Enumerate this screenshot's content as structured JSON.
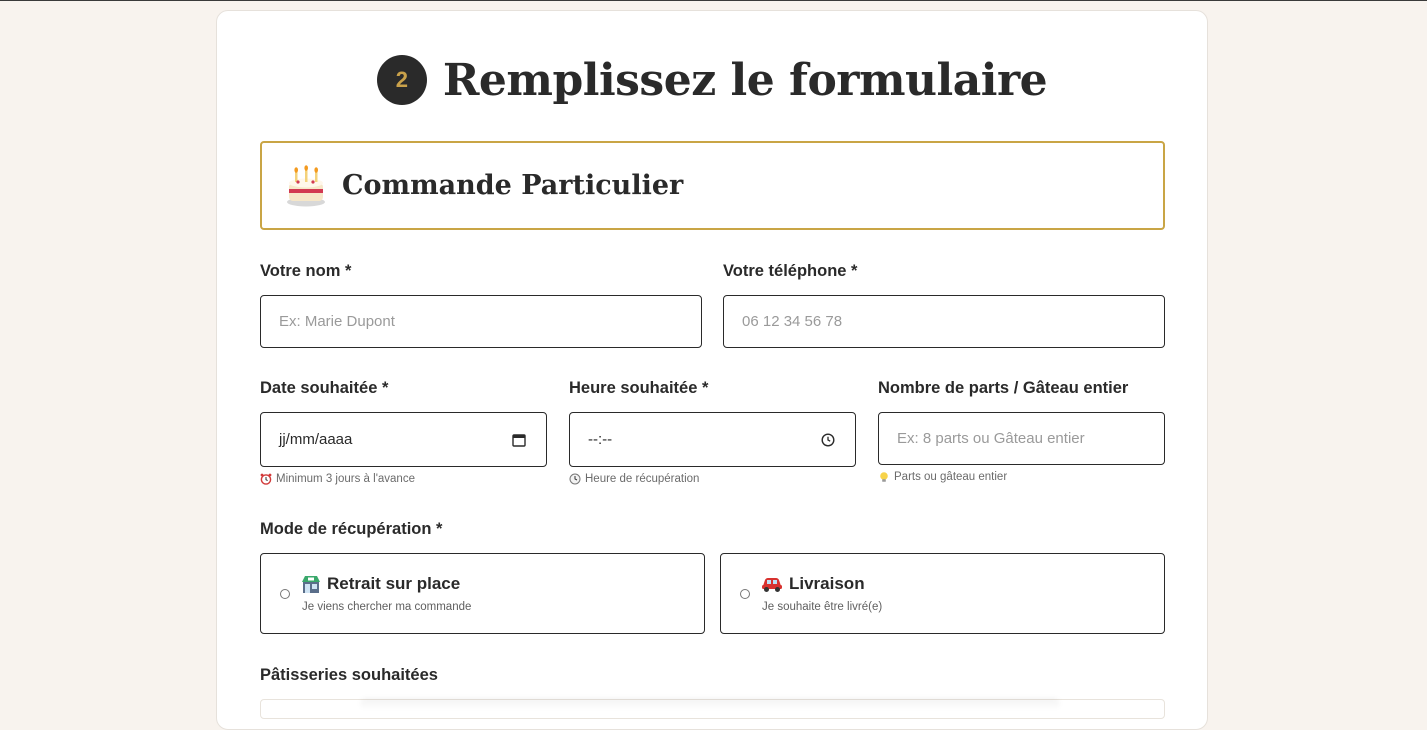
{
  "step": {
    "number": "2",
    "title": "Remplissez le formulaire"
  },
  "order_type": {
    "icon": "birthday-cake-icon",
    "title": "Commande Particulier"
  },
  "fields": {
    "name": {
      "label": "Votre nom *",
      "placeholder": "Ex: Marie Dupont"
    },
    "phone": {
      "label": "Votre téléphone *",
      "placeholder": "06 12 34 56 78"
    },
    "date": {
      "label": "Date souhaitée *",
      "value": "jj/mm/aaaa",
      "icon": "calendar-icon",
      "hint": "Minimum 3 jours à l'avance",
      "hint_icon": "alarm-clock-icon"
    },
    "time": {
      "label": "Heure souhaitée *",
      "value": "--:--",
      "icon": "clock-icon",
      "hint": "Heure de récupération",
      "hint_icon": "clock-icon"
    },
    "parts": {
      "label": "Nombre de parts / Gâteau entier",
      "placeholder": "Ex: 8 parts ou Gâteau entier",
      "hint": "Parts ou gâteau entier",
      "hint_icon": "lightbulb-icon"
    }
  },
  "pickup_mode": {
    "label": "Mode de récupération *",
    "options": [
      {
        "icon": "store-icon",
        "title": "Retrait sur place",
        "desc": "Je viens chercher ma commande",
        "selected": false
      },
      {
        "icon": "car-icon",
        "title": "Livraison",
        "desc": "Je souhaite être livré(e)",
        "selected": false
      }
    ]
  },
  "pastries": {
    "label": "Pâtisseries souhaitées"
  },
  "colors": {
    "accent_gold": "#c9a545",
    "dark": "#2a2a2a",
    "background": "#f8f3ee"
  }
}
